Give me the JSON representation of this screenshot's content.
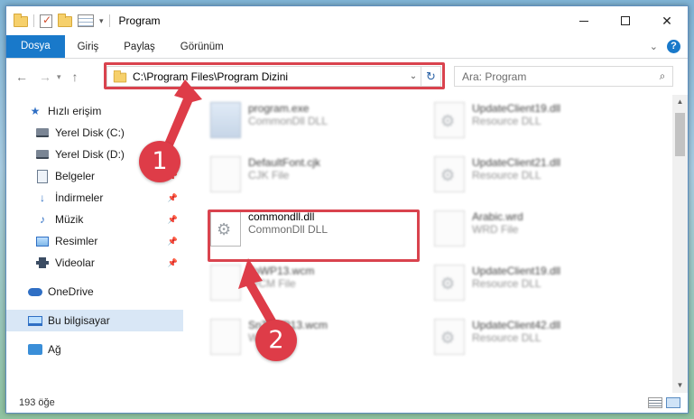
{
  "window": {
    "title": "Program",
    "min_label": "",
    "close_label": "✕"
  },
  "ribbon": {
    "tabs": [
      "Dosya",
      "Giriş",
      "Paylaş",
      "Görünüm"
    ],
    "help_label": "?"
  },
  "address": {
    "path": "C:\\Program Files\\Program Dizini"
  },
  "search": {
    "placeholder": "Ara: Program"
  },
  "sidebar": {
    "items": [
      {
        "label": "Hızlı erişim",
        "icon": "star-icon"
      },
      {
        "label": "Yerel Disk (C:)",
        "icon": "drive-icon",
        "pinned": true
      },
      {
        "label": "Yerel Disk (D:)",
        "icon": "drive-icon",
        "pinned": true
      },
      {
        "label": "Belgeler",
        "icon": "documents-icon",
        "pinned": true
      },
      {
        "label": "İndirmeler",
        "icon": "download-icon",
        "pinned": true
      },
      {
        "label": "Müzik",
        "icon": "music-icon",
        "pinned": true
      },
      {
        "label": "Resimler",
        "icon": "pictures-icon",
        "pinned": true
      },
      {
        "label": "Videolar",
        "icon": "videos-icon",
        "pinned": true
      },
      {
        "label": "OneDrive",
        "icon": "onedrive-icon"
      },
      {
        "label": "Bu bilgisayar",
        "icon": "this-pc-icon",
        "selected": true
      },
      {
        "label": "Ağ",
        "icon": "network-icon"
      }
    ]
  },
  "files": {
    "left": [
      {
        "name": "program.exe",
        "type": "CommonDll DLL",
        "blurred": true
      },
      {
        "name": "DefaultFont.cjk",
        "type": "CJK File",
        "blurred": true
      },
      {
        "name": "commondll.dll",
        "type": "CommonDll DLL",
        "blurred": false
      },
      {
        "name": "ToWP13.wcm",
        "type": "WCM File",
        "blurred": true
      },
      {
        "name": "SnToWP13.wcm",
        "type": "WCM File",
        "blurred": true
      }
    ],
    "right": [
      {
        "name": "UpdateClient19.dll",
        "type": "Resource DLL",
        "blurred": true
      },
      {
        "name": "UpdateClient21.dll",
        "type": "Resource DLL",
        "blurred": true
      },
      {
        "name": "Arabic.wrd",
        "type": "WRD File",
        "blurred": true
      },
      {
        "name": "UpdateClient19.dll",
        "type": "Resource DLL",
        "blurred": true
      },
      {
        "name": "UpdateClient42.dll",
        "type": "Resource DLL",
        "blurred": true
      }
    ]
  },
  "status": {
    "count": "193 öğe"
  },
  "callouts": {
    "one": "1",
    "two": "2"
  },
  "colors": {
    "accent": "#1979ca",
    "highlight": "#d9434e",
    "selected_nav": "#d9e7f6"
  }
}
